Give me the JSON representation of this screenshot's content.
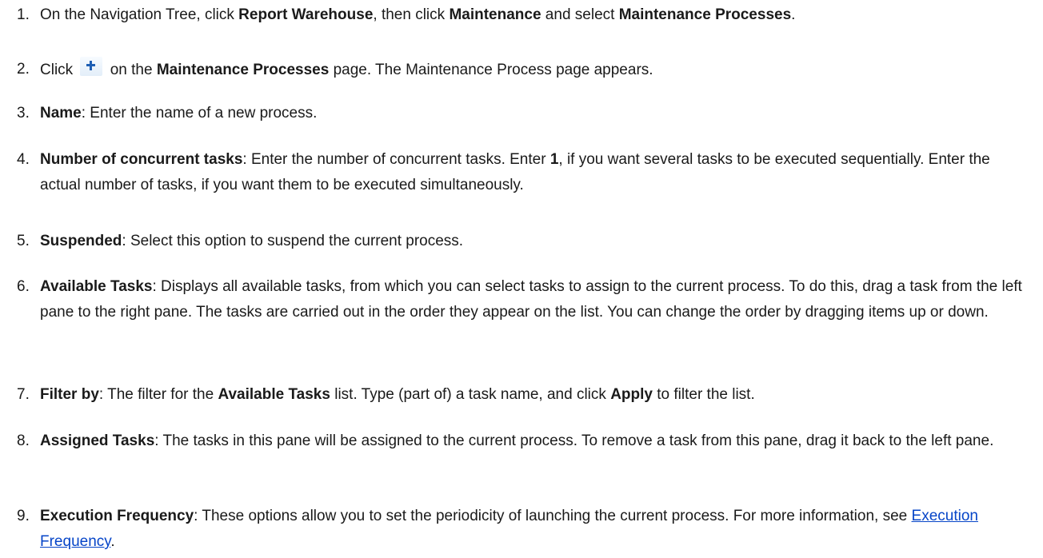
{
  "steps": [
    {
      "num": "1.",
      "parts": [
        {
          "t": "On the Navigation Tree, click "
        },
        {
          "b": "Report Warehouse"
        },
        {
          "t": ", then click "
        },
        {
          "b": "Maintenance"
        },
        {
          "t": " and select "
        },
        {
          "b": "Maintenance Processes"
        },
        {
          "t": "."
        }
      ]
    },
    {
      "num": "2.",
      "parts": [
        {
          "t": "Click "
        },
        {
          "icon": "plus-icon"
        },
        {
          "t": " on the "
        },
        {
          "b": "Maintenance Processes"
        },
        {
          "t": " page. The Maintenance Process page appears."
        }
      ]
    },
    {
      "num": "3.",
      "parts": [
        {
          "b": "Name"
        },
        {
          "t": ": Enter the name of a new process."
        }
      ]
    },
    {
      "num": "4.",
      "parts": [
        {
          "b": "Number of concurrent tasks"
        },
        {
          "t": ": Enter the number of concurrent tasks. Enter "
        },
        {
          "b": "1"
        },
        {
          "t": ", if you want several tasks to be executed sequentially. Enter the actual number of tasks, if you want them to be executed simultaneously."
        }
      ]
    },
    {
      "num": "5.",
      "parts": [
        {
          "b": "Suspended"
        },
        {
          "t": ": Select this option to suspend the current process."
        }
      ]
    },
    {
      "num": "6.",
      "parts": [
        {
          "b": "Available Tasks"
        },
        {
          "t": ": Displays all available tasks, from which you can select tasks to assign to the current process. To do this, drag a task from the left pane to the right pane. The tasks are carried out in the order they appear on the list. You can change the order by dragging items up or down."
        }
      ]
    },
    {
      "num": "7.",
      "parts": [
        {
          "b": "Filter by"
        },
        {
          "t": ": The filter for the "
        },
        {
          "b": "Available Tasks"
        },
        {
          "t": " list. Type (part of) a task name, and click "
        },
        {
          "b": "Apply"
        },
        {
          "t": " to filter the list."
        }
      ]
    },
    {
      "num": "8.",
      "parts": [
        {
          "b": "Assigned Tasks"
        },
        {
          "t": ": The tasks in this pane will be assigned to the current process. To remove a task from this pane, drag it back to the left pane."
        }
      ]
    },
    {
      "num": "9.",
      "parts": [
        {
          "b": "Execution Frequency"
        },
        {
          "t": ": These options allow you to set the periodicity of launching the current process. For more information, see "
        },
        {
          "link": "Execution Frequency"
        },
        {
          "t": "."
        }
      ]
    }
  ]
}
